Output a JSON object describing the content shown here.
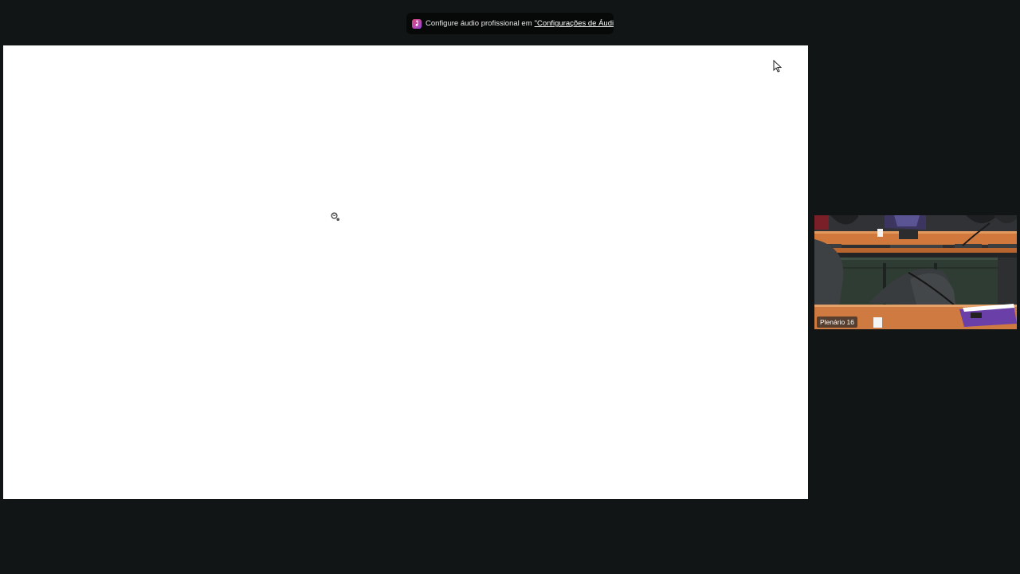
{
  "notification": {
    "icon": "music-note-icon",
    "text": "Configure áudio profissional em",
    "link_text": "\"Configurações de Áudio\""
  },
  "shared_screen": {
    "cursor_icon": "mouse-pointer-icon",
    "busy_cursor_icon": "busy-cursor-icon"
  },
  "participant": {
    "name": "Plenário 16"
  },
  "colors": {
    "background": "#111516",
    "share_surface": "#ffffff",
    "icon_gradient_start": "#e0457b",
    "icon_gradient_end": "#9b46d8"
  }
}
